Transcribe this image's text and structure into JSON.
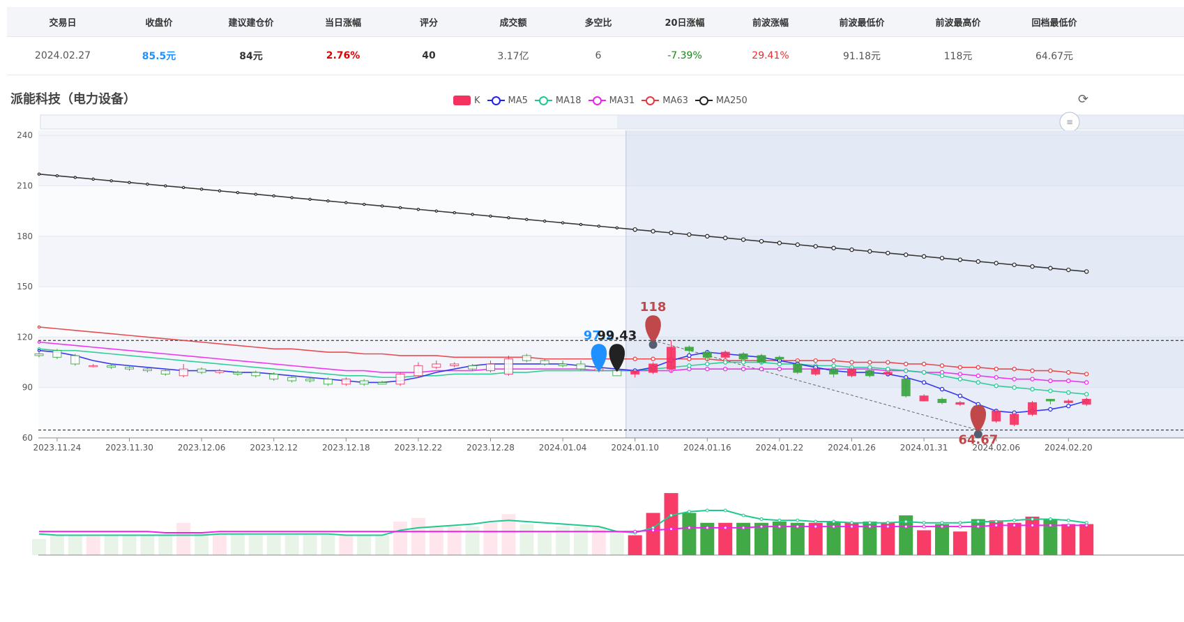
{
  "summary": {
    "headers": [
      "交易日",
      "收盘价",
      "建议建仓价",
      "当日涨幅",
      "评分",
      "成交额",
      "多空比",
      "20日涨幅",
      "前波涨幅",
      "前波最低价",
      "前波最高价",
      "回档最低价"
    ],
    "values": [
      "2024.02.27",
      "85.5元",
      "84元",
      "2.76%",
      "40",
      "3.17亿",
      "6",
      "-7.39%",
      "29.41%",
      "91.18元",
      "118元",
      "64.67元"
    ],
    "value_colors": [
      "#555555",
      "#1e90ff",
      "#333333",
      "#e00000",
      "#333333",
      "#555555",
      "#555555",
      "#138a13",
      "#e53030",
      "#555555",
      "#555555",
      "#555555"
    ]
  },
  "chart": {
    "stock_title": "派能科技（电力设备）",
    "refresh_icon": "refresh-icon",
    "legend": [
      {
        "label": "K",
        "color": "#f5315f",
        "kind": "bar"
      },
      {
        "label": "MA5",
        "color": "#2222ee",
        "kind": "line"
      },
      {
        "label": "MA18",
        "color": "#1ec98e",
        "kind": "line"
      },
      {
        "label": "MA31",
        "color": "#ee22ee",
        "kind": "line"
      },
      {
        "label": "MA63",
        "color": "#e8383d",
        "kind": "line"
      },
      {
        "label": "MA250",
        "color": "#222222",
        "kind": "line"
      }
    ],
    "colors": {
      "up": "#f5315f",
      "down": "#37a53c",
      "ma5": "#2222ee",
      "ma18": "#1ec98e",
      "ma31": "#ee22ee",
      "ma63": "#e8383d",
      "ma250": "#222222",
      "pin_blue": "#1e90ff",
      "pin_black": "#222222",
      "pin_red": "#c0484a"
    }
  },
  "chart_data": {
    "type": "candlestick",
    "y_ticks": [
      60,
      90,
      120,
      150,
      180,
      210,
      240
    ],
    "ylim": [
      60,
      243
    ],
    "x_ticks": [
      "2023.11.24",
      "2023.11.30",
      "2023.12.06",
      "2023.12.12",
      "2023.12.18",
      "2023.12.22",
      "2023.12.28",
      "2024.01.04",
      "2024.01.10",
      "2024.01.16",
      "2024.01.22",
      "2024.01.26",
      "2024.01.31",
      "2024.02.06",
      "2024.02.20"
    ],
    "x_tick_index": [
      1,
      5,
      9,
      13,
      17,
      21,
      25,
      29,
      33,
      37,
      41,
      45,
      49,
      53,
      57
    ],
    "candles": [
      [
        110,
        109,
        111,
        108
      ],
      [
        112,
        108,
        113,
        107
      ],
      [
        109,
        104,
        110,
        103
      ],
      [
        103,
        103,
        104,
        102
      ],
      [
        103,
        102,
        104,
        101
      ],
      [
        102,
        101,
        103,
        100
      ],
      [
        101,
        100,
        102,
        99
      ],
      [
        100,
        98,
        101,
        97
      ],
      [
        97,
        101,
        104,
        96
      ],
      [
        101,
        99,
        102,
        98
      ],
      [
        99,
        100,
        101,
        98
      ],
      [
        99,
        98,
        100,
        97
      ],
      [
        99,
        97,
        100,
        96
      ],
      [
        98,
        95,
        99,
        94
      ],
      [
        96,
        94,
        97,
        93
      ],
      [
        95,
        94,
        96,
        93
      ],
      [
        95,
        92,
        96,
        91
      ],
      [
        92,
        95,
        96,
        91
      ],
      [
        94,
        92,
        95,
        91
      ],
      [
        93,
        92,
        94,
        92
      ],
      [
        92,
        98,
        99,
        91
      ],
      [
        97,
        103,
        105,
        96
      ],
      [
        102,
        104,
        106,
        101
      ],
      [
        103,
        104,
        105,
        102
      ],
      [
        103,
        101,
        104,
        100
      ],
      [
        100,
        104,
        106,
        99
      ],
      [
        98,
        107,
        109,
        97
      ],
      [
        109,
        106,
        110,
        105
      ],
      [
        106,
        104,
        107,
        103
      ],
      [
        104,
        103,
        106,
        102
      ],
      [
        104,
        101,
        106,
        100
      ],
      [
        100,
        101,
        103,
        99
      ],
      [
        100,
        97,
        101,
        97
      ],
      [
        98,
        100,
        100,
        96
      ],
      [
        99,
        104,
        105,
        98
      ],
      [
        101,
        114,
        118,
        99
      ],
      [
        114,
        112,
        115,
        110
      ],
      [
        111,
        108,
        112,
        106
      ],
      [
        108,
        111,
        112,
        107
      ],
      [
        110,
        107,
        111,
        106
      ],
      [
        109,
        105,
        110,
        104
      ],
      [
        108,
        107,
        109,
        105
      ],
      [
        104,
        99,
        106,
        98
      ],
      [
        98,
        101,
        102,
        97
      ],
      [
        101,
        98,
        102,
        96
      ],
      [
        97,
        101,
        102,
        96
      ],
      [
        100,
        97,
        101,
        96
      ],
      [
        98,
        99,
        100,
        97
      ],
      [
        95,
        85,
        96,
        84
      ],
      [
        82,
        85,
        86,
        82
      ],
      [
        83,
        81,
        84,
        80
      ],
      [
        80,
        81,
        82,
        79
      ],
      [
        79,
        73,
        80,
        72
      ],
      [
        70,
        76,
        77,
        69
      ],
      [
        68,
        74,
        75,
        67
      ],
      [
        74,
        81,
        82,
        73
      ],
      [
        83,
        82,
        83,
        80
      ],
      [
        81,
        82,
        83,
        80
      ],
      [
        80,
        83,
        84,
        79
      ]
    ],
    "ma5": [
      112,
      111,
      109,
      106,
      104,
      103,
      102,
      101,
      100,
      100,
      100,
      99,
      99,
      98,
      97,
      96,
      95,
      94,
      93,
      93,
      94,
      96,
      99,
      101,
      103,
      104,
      104,
      104,
      104,
      104,
      103,
      102,
      101,
      100,
      102,
      106,
      109,
      111,
      110,
      109,
      108,
      106,
      104,
      102,
      100,
      99,
      99,
      98,
      96,
      93,
      89,
      85,
      80,
      76,
      75,
      76,
      77,
      79,
      82
    ],
    "ma18": [
      113,
      112,
      112,
      111,
      110,
      109,
      108,
      107,
      106,
      105,
      104,
      103,
      102,
      101,
      100,
      99,
      98,
      97,
      97,
      96,
      96,
      97,
      97,
      98,
      98,
      98,
      99,
      99,
      100,
      100,
      100,
      100,
      100,
      100,
      101,
      102,
      103,
      104,
      105,
      105,
      105,
      104,
      104,
      103,
      103,
      102,
      102,
      101,
      100,
      99,
      97,
      95,
      93,
      91,
      90,
      89,
      88,
      87,
      86
    ],
    "ma31": [
      117,
      116,
      115,
      114,
      113,
      112,
      111,
      110,
      109,
      108,
      107,
      106,
      105,
      104,
      103,
      102,
      101,
      100,
      100,
      99,
      99,
      99,
      100,
      100,
      100,
      101,
      101,
      101,
      101,
      101,
      101,
      100,
      100,
      100,
      100,
      100,
      101,
      101,
      101,
      101,
      101,
      101,
      101,
      101,
      101,
      101,
      101,
      100,
      100,
      99,
      99,
      98,
      97,
      96,
      95,
      95,
      94,
      94,
      93
    ],
    "ma63": [
      126,
      125,
      124,
      123,
      122,
      121,
      120,
      119,
      118,
      117,
      116,
      115,
      114,
      113,
      113,
      112,
      111,
      111,
      110,
      110,
      109,
      109,
      109,
      108,
      108,
      108,
      108,
      108,
      107,
      107,
      107,
      107,
      107,
      107,
      107,
      107,
      107,
      107,
      106,
      106,
      106,
      106,
      106,
      106,
      106,
      105,
      105,
      105,
      104,
      104,
      103,
      102,
      102,
      101,
      101,
      100,
      100,
      99,
      98
    ],
    "ma250": [
      217,
      216,
      215,
      214,
      213,
      212,
      211,
      210,
      209,
      208,
      207,
      206,
      205,
      204,
      203,
      202,
      201,
      200,
      199,
      198,
      197,
      196,
      195,
      194,
      193,
      192,
      191,
      190,
      189,
      188,
      187,
      186,
      185,
      184,
      183,
      182,
      181,
      180,
      179,
      178,
      177,
      176,
      175,
      174,
      173,
      172,
      171,
      170,
      169,
      168,
      167,
      166,
      165,
      164,
      163,
      162,
      161,
      160,
      159
    ],
    "volumes": [
      1.3,
      1.6,
      1.6,
      1.6,
      1.6,
      1.6,
      1.6,
      1.6,
      2.6,
      1.8,
      1.7,
      1.7,
      1.6,
      1.6,
      1.6,
      1.6,
      1.6,
      1.6,
      1.6,
      1.6,
      2.7,
      3.0,
      2.3,
      2.3,
      2.3,
      2.6,
      3.3,
      2.5,
      1.9,
      2.3,
      2.3,
      2.3,
      1.9,
      1.6,
      3.4,
      5.0,
      3.4,
      2.6,
      2.6,
      2.6,
      2.6,
      2.7,
      2.6,
      2.6,
      2.7,
      2.6,
      2.7,
      2.6,
      3.2,
      2.0,
      2.5,
      1.9,
      2.9,
      2.8,
      2.6,
      3.1,
      2.9,
      2.5,
      2.5
    ],
    "vol_ma_a": [
      1.7,
      1.6,
      1.6,
      1.6,
      1.6,
      1.6,
      1.6,
      1.6,
      1.6,
      1.6,
      1.7,
      1.7,
      1.7,
      1.7,
      1.7,
      1.7,
      1.7,
      1.6,
      1.6,
      1.6,
      2.0,
      2.2,
      2.3,
      2.4,
      2.5,
      2.7,
      2.8,
      2.7,
      2.6,
      2.5,
      2.4,
      2.3,
      1.9,
      1.8,
      2.2,
      3.2,
      3.5,
      3.6,
      3.6,
      3.2,
      2.9,
      2.8,
      2.8,
      2.7,
      2.7,
      2.6,
      2.6,
      2.6,
      2.7,
      2.6,
      2.6,
      2.6,
      2.7,
      2.7,
      2.8,
      2.9,
      2.9,
      2.8,
      2.6
    ],
    "vol_ma_b": [
      1.9,
      1.9,
      1.9,
      1.9,
      1.9,
      1.9,
      1.9,
      1.8,
      1.8,
      1.8,
      1.9,
      1.9,
      1.9,
      1.9,
      1.9,
      1.9,
      1.9,
      1.9,
      1.9,
      1.9,
      1.9,
      1.9,
      1.9,
      1.9,
      1.9,
      1.9,
      1.9,
      1.9,
      1.9,
      1.9,
      1.9,
      1.9,
      1.9,
      1.9,
      2.0,
      2.1,
      2.2,
      2.2,
      2.2,
      2.2,
      2.3,
      2.3,
      2.3,
      2.3,
      2.3,
      2.3,
      2.3,
      2.3,
      2.3,
      2.3,
      2.3,
      2.3,
      2.3,
      2.4,
      2.4,
      2.4,
      2.4,
      2.4,
      2.4
    ],
    "pins": [
      {
        "label": "97.2",
        "index": 31,
        "price": 101,
        "color": "pin_blue"
      },
      {
        "label": "99.43",
        "index": 32,
        "price": 101,
        "color": "pin_black"
      },
      {
        "label": "118",
        "index": 34,
        "price": 118,
        "color": "pin_red"
      },
      {
        "label": "64.67",
        "index": 52,
        "price": 64.67,
        "color": "pin_red"
      }
    ],
    "hlines": [
      118,
      64.67
    ],
    "highlight_from_index": 32.5
  }
}
